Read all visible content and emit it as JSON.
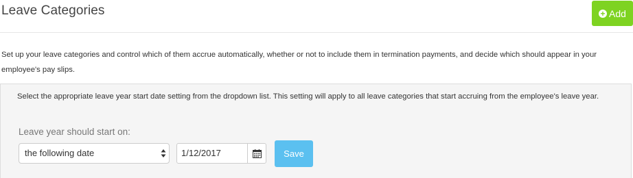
{
  "header": {
    "title": "Leave Categories",
    "add_label": "Add"
  },
  "intro_text": "Set up your leave categories and control which of them accrue automatically, whether or not to include them in termination payments, and decide which should appear in your employee's pay slips.",
  "leave_year_panel": {
    "description": "Select the appropriate leave year start date setting from the dropdown list. This setting will apply to all leave categories that start accruing from the employee's leave year.",
    "start_label": "Leave year should start on:",
    "start_option_selected": "the following date",
    "start_date_value": "1/12/2017",
    "save_label": "Save"
  },
  "colors": {
    "add_button": "#7ed321",
    "save_button": "#5bc0f0",
    "panel_bg": "#f5f5f5"
  },
  "icons": {
    "add": "plus-circle-icon",
    "select": "select-arrows-icon",
    "calendar": "calendar-icon"
  }
}
